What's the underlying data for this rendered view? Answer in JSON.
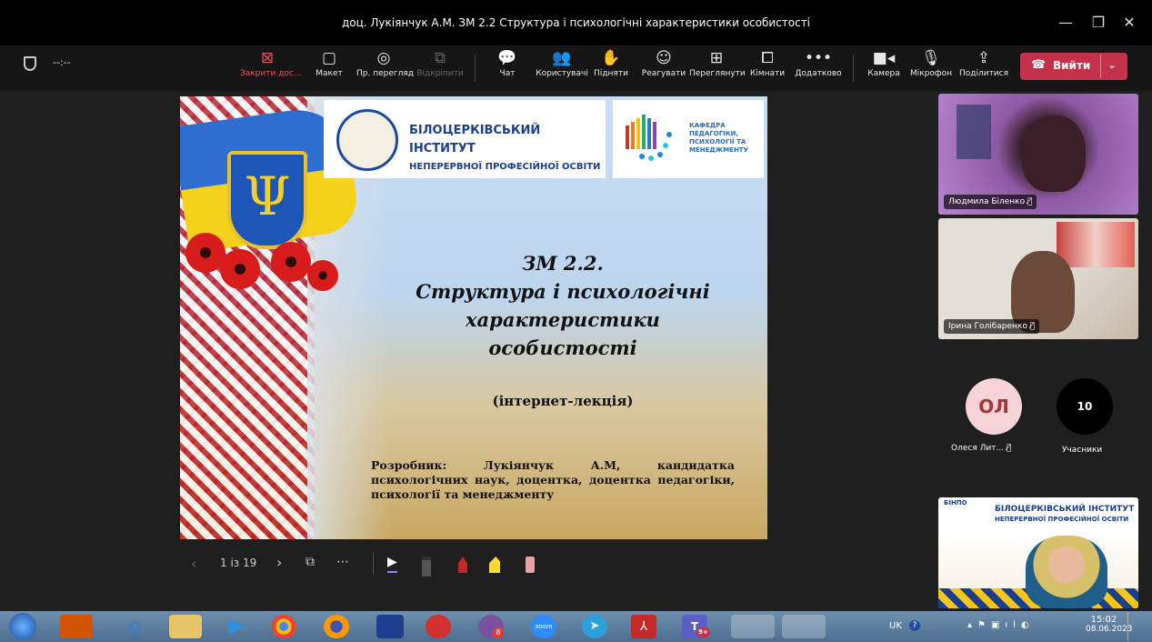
{
  "window": {
    "title": "доц. Лукіянчук А.М. ЗМ 2.2 Структура і психологічні характеристики особистості",
    "controls": {
      "minimize": "—",
      "restore": "❐",
      "close": "✕"
    }
  },
  "toolbar": {
    "timer": "--:--",
    "items": [
      {
        "label": "Закрити дос...",
        "icon": "stop-share-icon"
      },
      {
        "label": "Макет",
        "icon": "layout-icon"
      },
      {
        "label": "Пр. перегляд",
        "icon": "preview-icon"
      },
      {
        "label": "Відкріпити",
        "icon": "popout-icon"
      },
      {
        "label": "Чат",
        "icon": "chat-icon"
      },
      {
        "label": "Користувачі",
        "icon": "people-icon"
      },
      {
        "label": "Підняти",
        "icon": "raise-hand-icon"
      },
      {
        "label": "Реагувати",
        "icon": "react-icon"
      },
      {
        "label": "Переглянути",
        "icon": "view-icon"
      },
      {
        "label": "Кімнати",
        "icon": "rooms-icon"
      },
      {
        "label": "Додатково",
        "icon": "more-icon"
      },
      {
        "label": "Камера",
        "icon": "camera-icon"
      },
      {
        "label": "Мікрофон",
        "icon": "mic-icon"
      },
      {
        "label": "Поділитися",
        "icon": "share-icon"
      }
    ],
    "leave_label": "Вийти"
  },
  "slide": {
    "logo1_line1": "БІЛОЦЕРКІВСЬКИЙ ІНСТИТУТ",
    "logo1_line2": "НЕПЕРЕРВНОЇ ПРОФЕСІЙНОЇ ОСВІТИ",
    "logo2_text": "КАФЕДРА ПЕДАГОГІКИ, ПСИХОЛОГІЇ ТА МЕНЕДЖМЕНТУ",
    "title_line1": "ЗМ 2.2.",
    "title_line2": "Структура і психологічні",
    "title_line3": "характеристики",
    "title_line4": "особистості",
    "subtitle": "(інтернет-лекція)",
    "author": "Розробник: Лукіянчук А.М, кандидатка психологічних наук, доцентка, доцентка педагогіки, психології та менеджменту"
  },
  "slide_nav": {
    "page": "1 із 19"
  },
  "participants": {
    "tile1_name": "Людмила Біленко",
    "tile2_name": "Ірина Голібаренко",
    "avatar_initials": "ОЛ",
    "avatar_name": "Олеся Лит...",
    "count": "10",
    "count_label": "Учасники",
    "self_view_banner_line1": "БІНПО",
    "self_view_banner_line2": "БІЛОЦЕРКІВСЬКИЙ ІНСТИТУТ",
    "self_view_banner_line3": "НЕПЕРЕРВНОЇ ПРОФЕСІЙНОЇ ОСВІТИ"
  },
  "taskbar": {
    "lang": "UK",
    "time": "15:02",
    "date": "08.06.2023",
    "teams_badge": "9+",
    "viber_badge": "8",
    "zoom_label": "zoom"
  },
  "colors": {
    "leave": "#c4314b",
    "avatar_bg": "#f6d3d8",
    "avatar_text": "#a4373a",
    "accent_pen": "#8b8bf0"
  }
}
